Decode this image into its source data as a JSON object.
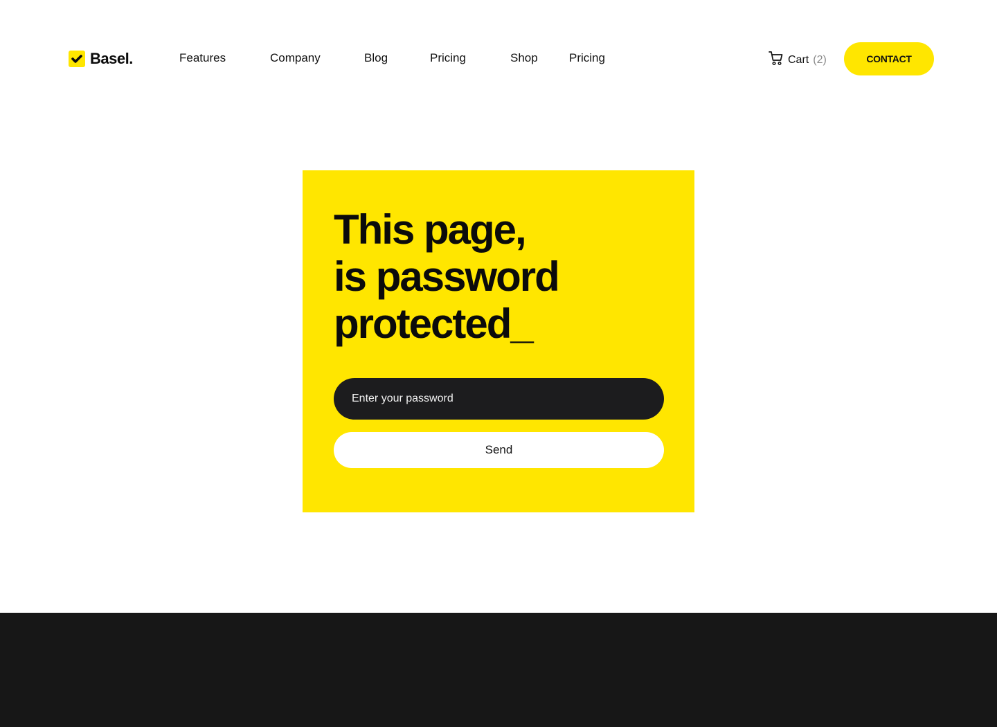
{
  "brand": {
    "name": "Basel.",
    "accent_color": "#FFE600",
    "logo_icon": "checkmark-icon"
  },
  "nav": {
    "items": [
      {
        "label": "Features"
      },
      {
        "label": "Company"
      },
      {
        "label": "Blog"
      },
      {
        "label": "Pricing"
      },
      {
        "label": "Shop"
      },
      {
        "label": "Pricing"
      }
    ]
  },
  "header_actions": {
    "cart_icon": "cart-icon",
    "cart_label": "Cart",
    "cart_count": "(2)",
    "contact_label": "CONTACT"
  },
  "password_card": {
    "headline_lines": [
      "This page,",
      "is password",
      "protected_"
    ],
    "password_placeholder": "Enter your password",
    "password_value": "",
    "send_label": "Send"
  },
  "footer": {
    "background_color": "#171717"
  }
}
